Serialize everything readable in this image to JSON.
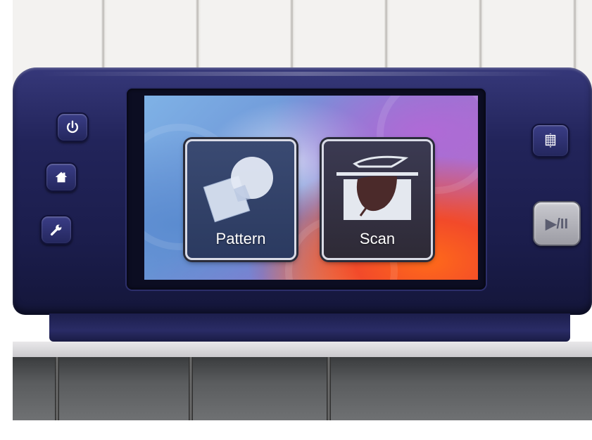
{
  "device": {
    "screen": {
      "tiles": [
        {
          "label": "Pattern",
          "icon": "pattern-shapes-icon"
        },
        {
          "label": "Scan",
          "icon": "scan-leaf-icon"
        }
      ]
    },
    "left_buttons": [
      {
        "icon": "power-icon"
      },
      {
        "icon": "home-icon"
      },
      {
        "icon": "wrench-icon"
      }
    ],
    "right_buttons": [
      {
        "icon": "grid-adjust-icon"
      },
      {
        "icon": "play-pause-icon",
        "label": "▶/II"
      }
    ]
  },
  "colors": {
    "device_body": "#22245a",
    "tile_border": "#d9dbe6",
    "play_button": "#b3b3ba"
  }
}
